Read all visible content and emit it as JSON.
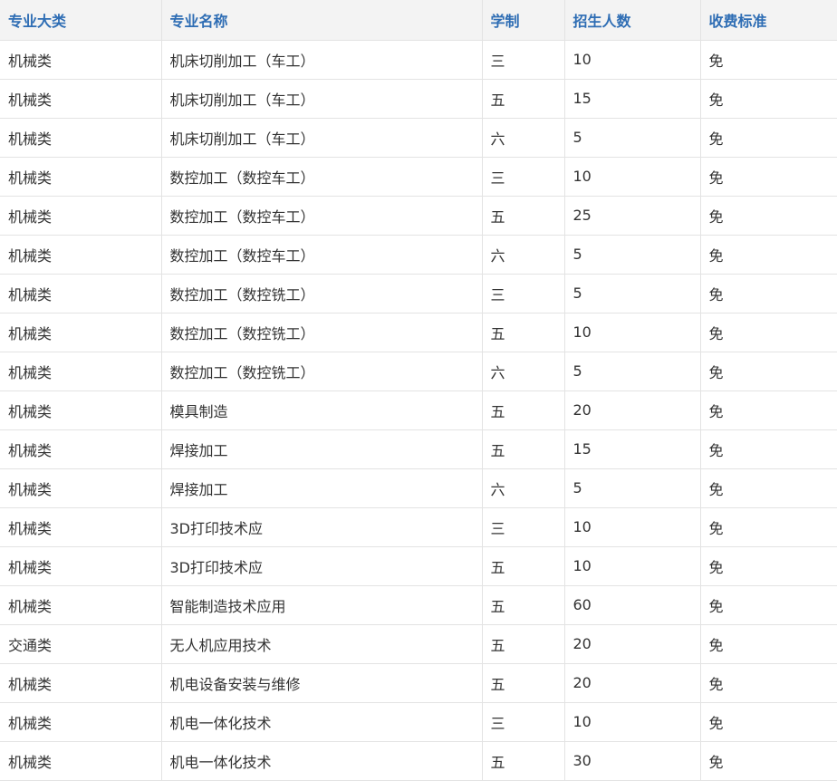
{
  "table": {
    "headers": [
      "专业大类",
      "专业名称",
      "学制",
      "招生人数",
      "收费标准"
    ],
    "rows": [
      [
        "机械类",
        "机床切削加工（车工）",
        "三",
        "10",
        "免"
      ],
      [
        "机械类",
        "机床切削加工（车工）",
        "五",
        "15",
        "免"
      ],
      [
        "机械类",
        "机床切削加工（车工）",
        "六",
        "5",
        "免"
      ],
      [
        "机械类",
        "数控加工（数控车工）",
        "三",
        "10",
        "免"
      ],
      [
        "机械类",
        "数控加工（数控车工）",
        "五",
        "25",
        "免"
      ],
      [
        "机械类",
        "数控加工（数控车工）",
        "六",
        "5",
        "免"
      ],
      [
        "机械类",
        "数控加工（数控铣工）",
        "三",
        "5",
        "免"
      ],
      [
        "机械类",
        "数控加工（数控铣工）",
        "五",
        "10",
        "免"
      ],
      [
        "机械类",
        "数控加工（数控铣工）",
        "六",
        "5",
        "免"
      ],
      [
        "机械类",
        "模具制造",
        "五",
        "20",
        "免"
      ],
      [
        "机械类",
        "焊接加工",
        "五",
        "15",
        "免"
      ],
      [
        "机械类",
        "焊接加工",
        "六",
        "5",
        "免"
      ],
      [
        "机械类",
        "3D打印技术应",
        "三",
        "10",
        "免"
      ],
      [
        "机械类",
        "3D打印技术应",
        "五",
        "10",
        "免"
      ],
      [
        "机械类",
        "智能制造技术应用",
        "五",
        "60",
        "免"
      ],
      [
        "交通类",
        "无人机应用技术",
        "五",
        "20",
        "免"
      ],
      [
        "机械类",
        "机电设备安装与维修",
        "五",
        "20",
        "免"
      ],
      [
        "机械类",
        "机电一体化技术",
        "三",
        "10",
        "免"
      ],
      [
        "机械类",
        "机电一体化技术",
        "五",
        "30",
        "免"
      ]
    ]
  },
  "colors": {
    "header_text": "#2e6db4",
    "header_bg": "#f3f3f3",
    "cell_text": "#333333",
    "border": "#e3e3e3"
  }
}
